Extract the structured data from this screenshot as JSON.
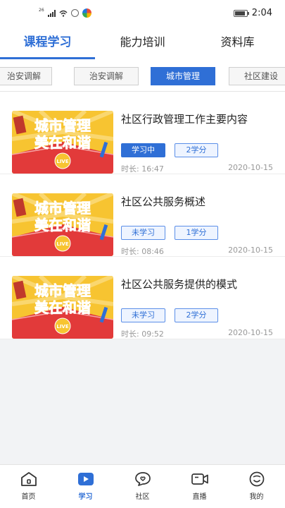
{
  "status_bar": {
    "signal_text": "26",
    "time": "2:04"
  },
  "tabs": [
    {
      "label": "课程学习",
      "active": true
    },
    {
      "label": "能力培训",
      "active": false
    },
    {
      "label": "资料库",
      "active": false
    }
  ],
  "categories": [
    {
      "label": "治安调解",
      "selected": false
    },
    {
      "label": "治安调解",
      "selected": false
    },
    {
      "label": "城市管理",
      "selected": true
    },
    {
      "label": "社区建设",
      "selected": false
    }
  ],
  "thumbnail": {
    "line1": "城市管理",
    "line2": "美在和谐",
    "badge": "LIVE"
  },
  "courses": [
    {
      "title": "社区行政管理工作主要内容",
      "status": "学习中",
      "credits": "2学分",
      "duration": "时长: 16:47",
      "date": "2020-10-15"
    },
    {
      "title": "社区公共服务概述",
      "status": "未学习",
      "credits": "1学分",
      "duration": "时长: 08:46",
      "date": "2020-10-15"
    },
    {
      "title": "社区公共服务提供的模式",
      "status": "未学习",
      "credits": "2学分",
      "duration": "时长: 09:52",
      "date": "2020-10-15"
    }
  ],
  "bottom_nav": [
    {
      "label": "首页",
      "icon": "home-icon",
      "active": false
    },
    {
      "label": "学习",
      "icon": "play-icon",
      "active": true
    },
    {
      "label": "社区",
      "icon": "chat-heart-icon",
      "active": false
    },
    {
      "label": "直播",
      "icon": "video-camera-icon",
      "active": false
    },
    {
      "label": "我的",
      "icon": "smile-icon",
      "active": false
    }
  ],
  "colors": {
    "accent": "#2f6fd6",
    "thumb_yellow": "#f7c431",
    "thumb_red": "#e23a3a"
  }
}
